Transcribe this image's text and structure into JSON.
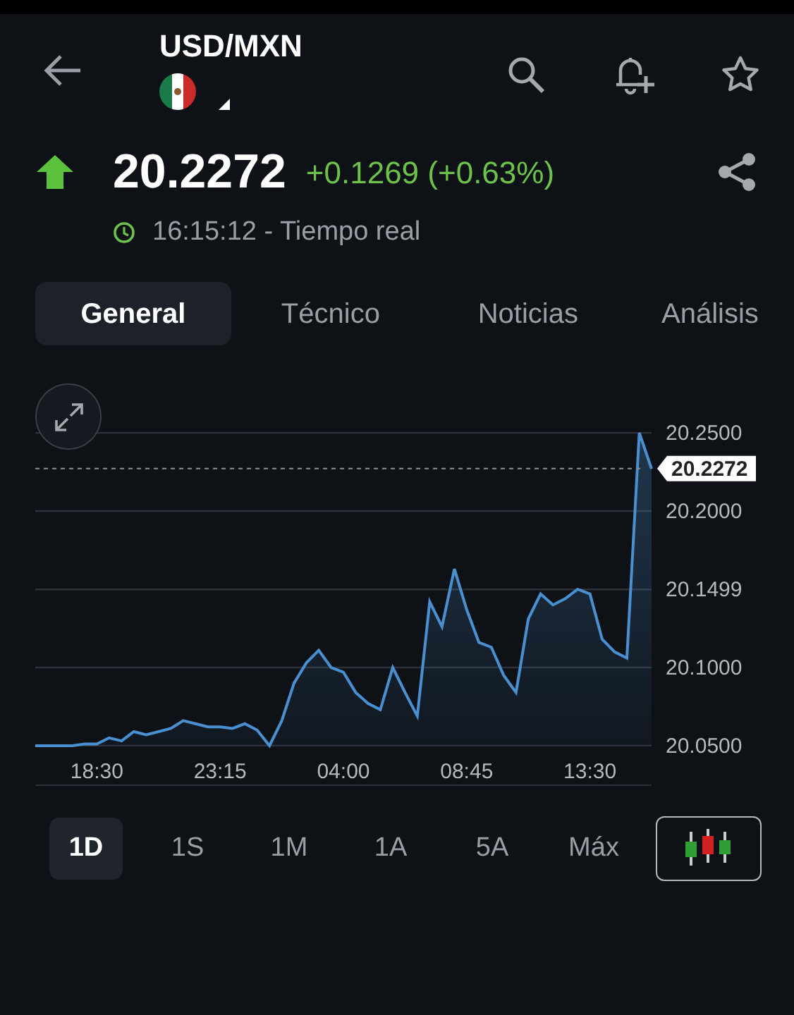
{
  "header": {
    "title": "USD/MXN"
  },
  "quote": {
    "price": "20.2272",
    "change": "+0.1269 (+0.63%)",
    "time": "16:15:12 - Tiempo real"
  },
  "tabs": [
    {
      "label": "General",
      "selected": true
    },
    {
      "label": "Técnico",
      "selected": false
    },
    {
      "label": "Noticias",
      "selected": false
    },
    {
      "label": "Análisis",
      "selected": false
    }
  ],
  "chart": {
    "chart_data": {
      "type": "area",
      "grid": true,
      "ylim": [
        20.05,
        20.25
      ],
      "categories": [
        null,
        null,
        null,
        null,
        null,
        "18:30",
        null,
        null,
        null,
        null,
        null,
        null,
        null,
        null,
        null,
        "23:15",
        null,
        null,
        null,
        null,
        null,
        null,
        null,
        null,
        null,
        "04:00",
        null,
        null,
        null,
        null,
        null,
        null,
        null,
        null,
        null,
        "08:45",
        null,
        null,
        null,
        null,
        null,
        null,
        null,
        null,
        null,
        "13:30",
        null,
        null,
        null,
        null,
        null
      ],
      "series": [
        {
          "color": "#4a90d0",
          "values": [
            20.05,
            20.05,
            20.05,
            20.05,
            20.051,
            20.051,
            20.055,
            20.053,
            20.059,
            20.057,
            20.059,
            20.061,
            20.066,
            20.064,
            20.062,
            20.062,
            20.061,
            20.064,
            20.06,
            20.05,
            20.066,
            20.09,
            20.103,
            20.111,
            20.1,
            20.097,
            20.084,
            20.077,
            20.073,
            20.1,
            20.084,
            20.069,
            20.142,
            20.126,
            20.163,
            20.137,
            20.116,
            20.113,
            20.095,
            20.084,
            20.131,
            20.147,
            20.14,
            20.144,
            20.15,
            20.147,
            20.118,
            20.11,
            20.106,
            20.25,
            20.227
          ]
        }
      ],
      "yticks": [
        {
          "value": 20.25,
          "label": "20.2500"
        },
        {
          "value": 20.2,
          "label": "20.2000"
        },
        {
          "value": 20.1499,
          "label": "20.1499"
        },
        {
          "value": 20.1,
          "label": "20.1000"
        },
        {
          "value": 20.05,
          "label": "20.0500"
        }
      ],
      "ref_lines": [
        {
          "axis": "y",
          "value": 20.2272,
          "label": "20.2272"
        }
      ]
    }
  },
  "periods": [
    {
      "label": "1D",
      "selected": true
    },
    {
      "label": "1S",
      "selected": false
    },
    {
      "label": "1M",
      "selected": false
    },
    {
      "label": "1A",
      "selected": false
    },
    {
      "label": "5A",
      "selected": false
    },
    {
      "label": "Máx",
      "selected": false
    }
  ]
}
